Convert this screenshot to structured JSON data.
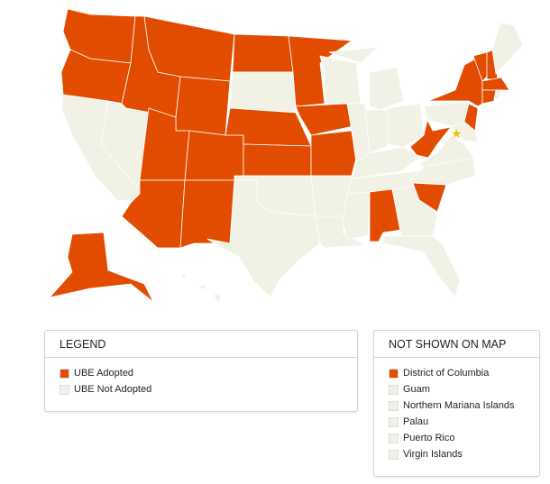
{
  "colors": {
    "adopted": "#e24c00",
    "not_adopted": "#f1f1e6",
    "border": "#ffffff",
    "dc_star": "#f2c200"
  },
  "map": {
    "adopted_states": [
      "WA",
      "OR",
      "ID",
      "MT",
      "WY",
      "UT",
      "CO",
      "AZ",
      "NM",
      "ND",
      "MN",
      "NE",
      "KS",
      "IA",
      "MO",
      "AL",
      "SC",
      "WV",
      "NY",
      "VT",
      "NH",
      "MA",
      "CT",
      "NJ",
      "AK"
    ],
    "dc_marker_icon": "star-icon"
  },
  "legend": {
    "title": "LEGEND",
    "items": [
      {
        "label": "UBE Adopted",
        "status": "adopted"
      },
      {
        "label": "UBE Not Adopted",
        "status": "not_adopted"
      }
    ]
  },
  "not_shown": {
    "title": "NOT SHOWN ON MAP",
    "items": [
      {
        "label": "District of Columbia",
        "status": "adopted"
      },
      {
        "label": "Guam",
        "status": "not_adopted"
      },
      {
        "label": "Northern Mariana Islands",
        "status": "not_adopted"
      },
      {
        "label": "Palau",
        "status": "not_adopted"
      },
      {
        "label": "Puerto Rico",
        "status": "not_adopted"
      },
      {
        "label": "Virgin Islands",
        "status": "not_adopted"
      }
    ]
  }
}
